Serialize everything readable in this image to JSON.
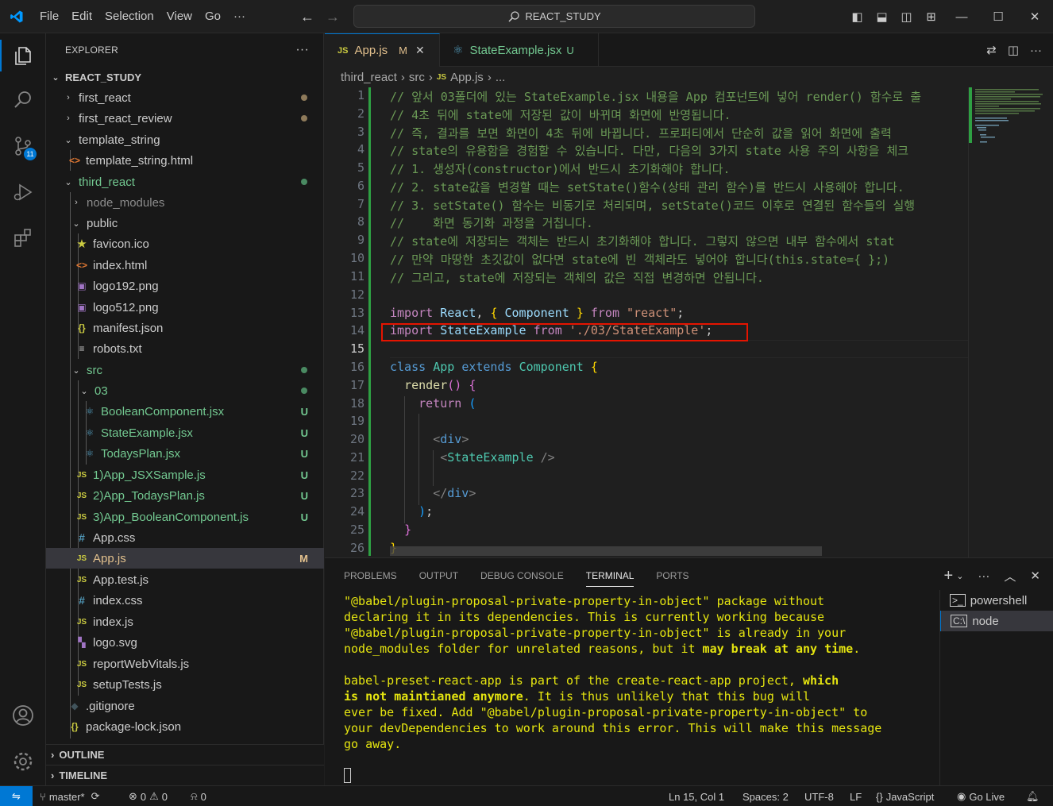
{
  "titlebar": {
    "menu": [
      "File",
      "Edit",
      "Selection",
      "View",
      "Go",
      "···"
    ],
    "search": "REACT_STUDY"
  },
  "activity": {
    "scm_badge": "11"
  },
  "sidebar": {
    "header": "EXPLORER",
    "more": "···",
    "root": "REACT_STUDY",
    "items": [
      {
        "label": "first_react"
      },
      {
        "label": "first_react_review"
      },
      {
        "label": "template_string"
      },
      {
        "label": "template_string.html"
      },
      {
        "label": "third_react"
      },
      {
        "label": "node_modules"
      },
      {
        "label": "public"
      },
      {
        "label": "favicon.ico"
      },
      {
        "label": "index.html"
      },
      {
        "label": "logo192.png"
      },
      {
        "label": "logo512.png"
      },
      {
        "label": "manifest.json"
      },
      {
        "label": "robots.txt"
      },
      {
        "label": "src"
      },
      {
        "label": "03"
      },
      {
        "label": "BooleanComponent.jsx",
        "status": "U"
      },
      {
        "label": "StateExample.jsx",
        "status": "U"
      },
      {
        "label": "TodaysPlan.jsx",
        "status": "U"
      },
      {
        "label": "1)App_JSXSample.js",
        "status": "U"
      },
      {
        "label": "2)App_TodaysPlan.js",
        "status": "U"
      },
      {
        "label": "3)App_BooleanComponent.js",
        "status": "U"
      },
      {
        "label": "App.css"
      },
      {
        "label": "App.js",
        "status": "M"
      },
      {
        "label": "App.test.js"
      },
      {
        "label": "index.css"
      },
      {
        "label": "index.js"
      },
      {
        "label": "logo.svg"
      },
      {
        "label": "reportWebVitals.js"
      },
      {
        "label": "setupTests.js"
      },
      {
        "label": ".gitignore"
      },
      {
        "label": "package-lock.json"
      }
    ],
    "outline": "OUTLINE",
    "timeline": "TIMELINE"
  },
  "tabs": [
    {
      "icon": "JS",
      "label": "App.js",
      "status": "M",
      "close": "✕"
    },
    {
      "icon": "⚛",
      "label": "StateExample.jsx",
      "status": "U"
    }
  ],
  "breadcrumb": [
    "third_react",
    "src",
    "JS",
    "App.js",
    "..."
  ],
  "line_numbers": [
    "1",
    "2",
    "3",
    "4",
    "5",
    "6",
    "7",
    "8",
    "9",
    "10",
    "11",
    "12",
    "13",
    "14",
    "15",
    "16",
    "17",
    "18",
    "19",
    "20",
    "21",
    "22",
    "23",
    "24",
    "25",
    "26"
  ],
  "code": {
    "l1": "// 앞서 03폴더에 있는 StateExample.jsx 내용을 App 컴포넌트에 넣어 render() 함수로 출",
    "l2": "// 4초 뒤에 state에 저장된 값이 바뀌며 화면에 반영됩니다.",
    "l3": "// 즉, 결과를 보면 화면이 4초 뒤에 바뀝니다. 프로퍼티에서 단순히 값을 읽어 화면에 출력",
    "l4": "// state의 유용함을 경험할 수 있습니다. 다만, 다음의 3가지 state 사용 주의 사항을 체크",
    "l5": "// 1. 생성자(constructor)에서 반드시 초기화해야 합니다.",
    "l6": "// 2. state값을 변경할 때는 setState()함수(상태 관리 함수)를 반드시 사용해야 합니다.",
    "l7": "// 3. setState() 함수는 비동기로 처리되며, setState()코드 이후로 연결된 함수들의 실행",
    "l8": "//    화면 동기화 과정을 거칩니다.",
    "l9": "// state에 저장되는 객체는 반드시 초기화해야 합니다. 그렇지 않으면 내부 함수에서 stat",
    "l10": "// 만약 마땅한 초깃값이 없다면 state에 빈 객체라도 넣어야 합니다(this.state={ };)",
    "l11": "// 그리고, state에 저장되는 객체의 값은 직접 변경하면 안됩니다.",
    "kw_import": "import",
    "kw_from": "from",
    "react_id": "React",
    "component_id": "Component",
    "react_str": "\"react\"",
    "stateexample_id": "StateExample",
    "path_str": "'./03/StateExample'",
    "kw_class": "class",
    "app_id": "App",
    "kw_extends": "extends",
    "render_fn": "render",
    "kw_return": "return",
    "div_open": "<div>",
    "div_close": "</div>",
    "state_tag": "StateExample"
  },
  "panel": {
    "tabs": [
      "PROBLEMS",
      "OUTPUT",
      "DEBUG CONSOLE",
      "TERMINAL",
      "PORTS"
    ],
    "terminal": {
      "l1": "\"@babel/plugin-proposal-private-property-in-object\" package without",
      "l2": "declaring it in its dependencies. This is currently working because",
      "l3": "\"@babel/plugin-proposal-private-property-in-object\" is already in your",
      "l4a": "node_modules folder for unrelated reasons, but it ",
      "l4b": "may break at any time",
      "l4c": ".",
      "l6a": "babel-preset-react-app is part of the create-react-app project, ",
      "l6b": "which",
      "l7a": "is not maintianed anymore",
      "l7b": ". It is thus unlikely that this bug will",
      "l8": "ever be fixed. Add \"@babel/plugin-proposal-private-property-in-object\" to",
      "l9": "your devDependencies to work around this error. This will make this message",
      "l10": "go away."
    },
    "sessions": [
      "powershell",
      "node"
    ]
  },
  "statusbar": {
    "branch": "master*",
    "errors": "0",
    "warnings": "0",
    "ports": "0",
    "position": "Ln 15, Col 1",
    "spaces": "Spaces: 2",
    "encoding": "UTF-8",
    "eol": "LF",
    "language": "JavaScript",
    "golive": "Go Live"
  },
  "colors": {
    "accent": "#0078d4",
    "untracked": "#73c991",
    "modified": "#e2c08d",
    "highlight_box": "#e51400"
  }
}
